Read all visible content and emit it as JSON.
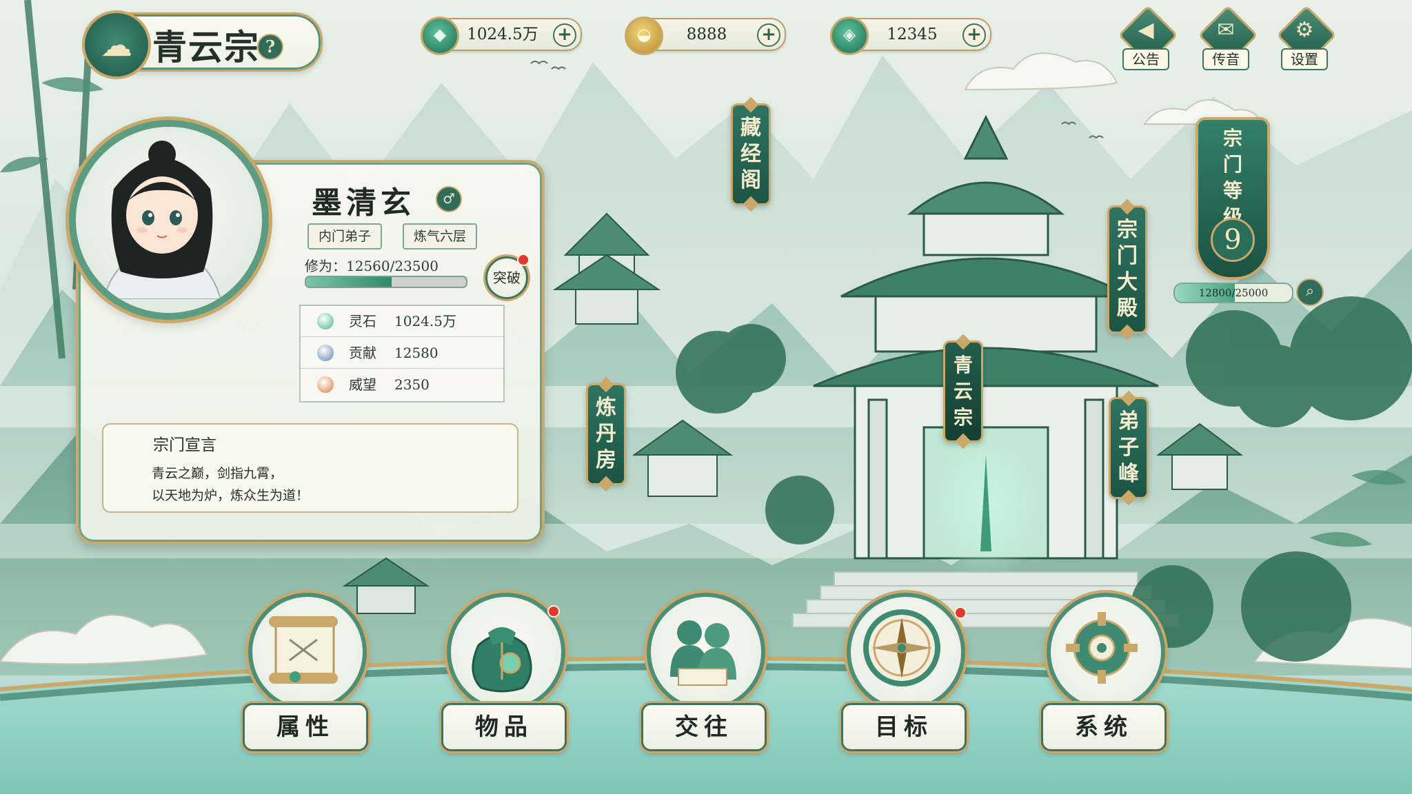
{
  "header": {
    "sect_name": "青云宗",
    "help_label": "?",
    "emblem_icon": "cloud-emblem-icon"
  },
  "currencies": [
    {
      "icon": "spirit-stone-icon",
      "value": "1024.5万",
      "plus": "+"
    },
    {
      "icon": "gold-ingot-icon",
      "value": "8888",
      "plus": "+"
    },
    {
      "icon": "jade-coin-icon",
      "value": "12345",
      "plus": "+"
    }
  ],
  "top_buttons": [
    {
      "icon": "megaphone-icon",
      "glyph": "◀",
      "label": "公告"
    },
    {
      "icon": "crane-icon",
      "glyph": "✉",
      "label": "传音"
    },
    {
      "icon": "gear-icon",
      "glyph": "⚙",
      "label": "设置"
    }
  ],
  "character": {
    "name": "墨清玄",
    "gender_glyph": "♂",
    "rank": "内门弟子",
    "realm": "炼气六层",
    "cultivation_label": "修为：12560/23500",
    "cultivation_progress": 0.534,
    "breakthrough_label": "突破",
    "stats": [
      {
        "icon": "spirit-stone-icon",
        "label": "灵石",
        "value": "1024.5万",
        "color": "#49b38a"
      },
      {
        "icon": "contribution-icon",
        "label": "贡献",
        "value": "12580",
        "color": "#5f7fb0"
      },
      {
        "icon": "prestige-icon",
        "label": "威望",
        "value": "2350",
        "color": "#d9793d"
      }
    ]
  },
  "motto": {
    "title": "宗门宣言",
    "line1": "青云之巅，剑指九霄，",
    "line2": "以天地为炉，炼众生为道！"
  },
  "buildings": [
    {
      "id": "library",
      "label": "藏经阁"
    },
    {
      "id": "main_hall",
      "label": "宗门大殿"
    },
    {
      "id": "alchemy",
      "label": "炼丹房"
    },
    {
      "id": "disciple_peak",
      "label": "弟子峰"
    },
    {
      "id": "gate_plaque",
      "label": "青云宗"
    }
  ],
  "sect_level": {
    "title": "宗门等级",
    "level": "9",
    "exp_text": "12800/25000",
    "exp_progress": 0.512
  },
  "bottom_nav": [
    {
      "icon": "scroll-icon",
      "label": "属性",
      "badge": false
    },
    {
      "icon": "pouch-icon",
      "label": "物品",
      "badge": true
    },
    {
      "icon": "companions-icon",
      "label": "交往",
      "badge": false
    },
    {
      "icon": "compass-icon",
      "label": "目标",
      "badge": true
    },
    {
      "icon": "cog-icon",
      "label": "系统",
      "badge": false
    }
  ],
  "colors": {
    "accent_jade": "#2f7461",
    "trim_gold": "#c9a86a",
    "alert_red": "#e3382c"
  }
}
